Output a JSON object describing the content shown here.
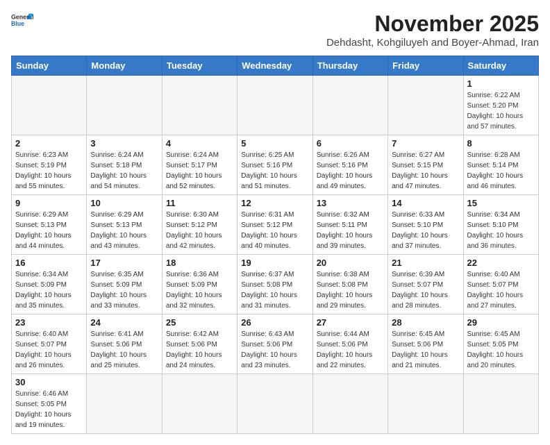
{
  "header": {
    "logo_general": "General",
    "logo_blue": "Blue",
    "month_year": "November 2025",
    "location": "Dehdasht, Kohgiluyeh and Boyer-Ahmad, Iran"
  },
  "weekdays": [
    "Sunday",
    "Monday",
    "Tuesday",
    "Wednesday",
    "Thursday",
    "Friday",
    "Saturday"
  ],
  "weeks": [
    [
      {
        "day": "",
        "info": ""
      },
      {
        "day": "",
        "info": ""
      },
      {
        "day": "",
        "info": ""
      },
      {
        "day": "",
        "info": ""
      },
      {
        "day": "",
        "info": ""
      },
      {
        "day": "",
        "info": ""
      },
      {
        "day": "1",
        "info": "Sunrise: 6:22 AM\nSunset: 5:20 PM\nDaylight: 10 hours\nand 57 minutes."
      }
    ],
    [
      {
        "day": "2",
        "info": "Sunrise: 6:23 AM\nSunset: 5:19 PM\nDaylight: 10 hours\nand 55 minutes."
      },
      {
        "day": "3",
        "info": "Sunrise: 6:24 AM\nSunset: 5:18 PM\nDaylight: 10 hours\nand 54 minutes."
      },
      {
        "day": "4",
        "info": "Sunrise: 6:24 AM\nSunset: 5:17 PM\nDaylight: 10 hours\nand 52 minutes."
      },
      {
        "day": "5",
        "info": "Sunrise: 6:25 AM\nSunset: 5:16 PM\nDaylight: 10 hours\nand 51 minutes."
      },
      {
        "day": "6",
        "info": "Sunrise: 6:26 AM\nSunset: 5:16 PM\nDaylight: 10 hours\nand 49 minutes."
      },
      {
        "day": "7",
        "info": "Sunrise: 6:27 AM\nSunset: 5:15 PM\nDaylight: 10 hours\nand 47 minutes."
      },
      {
        "day": "8",
        "info": "Sunrise: 6:28 AM\nSunset: 5:14 PM\nDaylight: 10 hours\nand 46 minutes."
      }
    ],
    [
      {
        "day": "9",
        "info": "Sunrise: 6:29 AM\nSunset: 5:13 PM\nDaylight: 10 hours\nand 44 minutes."
      },
      {
        "day": "10",
        "info": "Sunrise: 6:29 AM\nSunset: 5:13 PM\nDaylight: 10 hours\nand 43 minutes."
      },
      {
        "day": "11",
        "info": "Sunrise: 6:30 AM\nSunset: 5:12 PM\nDaylight: 10 hours\nand 42 minutes."
      },
      {
        "day": "12",
        "info": "Sunrise: 6:31 AM\nSunset: 5:12 PM\nDaylight: 10 hours\nand 40 minutes."
      },
      {
        "day": "13",
        "info": "Sunrise: 6:32 AM\nSunset: 5:11 PM\nDaylight: 10 hours\nand 39 minutes."
      },
      {
        "day": "14",
        "info": "Sunrise: 6:33 AM\nSunset: 5:10 PM\nDaylight: 10 hours\nand 37 minutes."
      },
      {
        "day": "15",
        "info": "Sunrise: 6:34 AM\nSunset: 5:10 PM\nDaylight: 10 hours\nand 36 minutes."
      }
    ],
    [
      {
        "day": "16",
        "info": "Sunrise: 6:34 AM\nSunset: 5:09 PM\nDaylight: 10 hours\nand 35 minutes."
      },
      {
        "day": "17",
        "info": "Sunrise: 6:35 AM\nSunset: 5:09 PM\nDaylight: 10 hours\nand 33 minutes."
      },
      {
        "day": "18",
        "info": "Sunrise: 6:36 AM\nSunset: 5:09 PM\nDaylight: 10 hours\nand 32 minutes."
      },
      {
        "day": "19",
        "info": "Sunrise: 6:37 AM\nSunset: 5:08 PM\nDaylight: 10 hours\nand 31 minutes."
      },
      {
        "day": "20",
        "info": "Sunrise: 6:38 AM\nSunset: 5:08 PM\nDaylight: 10 hours\nand 29 minutes."
      },
      {
        "day": "21",
        "info": "Sunrise: 6:39 AM\nSunset: 5:07 PM\nDaylight: 10 hours\nand 28 minutes."
      },
      {
        "day": "22",
        "info": "Sunrise: 6:40 AM\nSunset: 5:07 PM\nDaylight: 10 hours\nand 27 minutes."
      }
    ],
    [
      {
        "day": "23",
        "info": "Sunrise: 6:40 AM\nSunset: 5:07 PM\nDaylight: 10 hours\nand 26 minutes."
      },
      {
        "day": "24",
        "info": "Sunrise: 6:41 AM\nSunset: 5:06 PM\nDaylight: 10 hours\nand 25 minutes."
      },
      {
        "day": "25",
        "info": "Sunrise: 6:42 AM\nSunset: 5:06 PM\nDaylight: 10 hours\nand 24 minutes."
      },
      {
        "day": "26",
        "info": "Sunrise: 6:43 AM\nSunset: 5:06 PM\nDaylight: 10 hours\nand 23 minutes."
      },
      {
        "day": "27",
        "info": "Sunrise: 6:44 AM\nSunset: 5:06 PM\nDaylight: 10 hours\nand 22 minutes."
      },
      {
        "day": "28",
        "info": "Sunrise: 6:45 AM\nSunset: 5:06 PM\nDaylight: 10 hours\nand 21 minutes."
      },
      {
        "day": "29",
        "info": "Sunrise: 6:45 AM\nSunset: 5:05 PM\nDaylight: 10 hours\nand 20 minutes."
      }
    ],
    [
      {
        "day": "30",
        "info": "Sunrise: 6:46 AM\nSunset: 5:05 PM\nDaylight: 10 hours\nand 19 minutes."
      },
      {
        "day": "",
        "info": ""
      },
      {
        "day": "",
        "info": ""
      },
      {
        "day": "",
        "info": ""
      },
      {
        "day": "",
        "info": ""
      },
      {
        "day": "",
        "info": ""
      },
      {
        "day": "",
        "info": ""
      }
    ]
  ]
}
